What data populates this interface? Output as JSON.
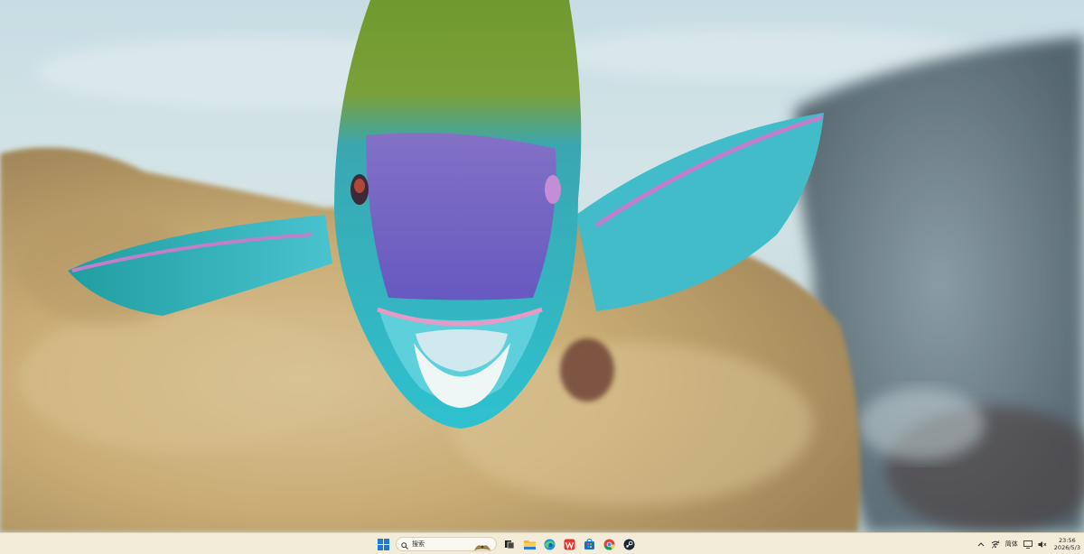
{
  "wallpaper": {
    "subject": "parrotfish-underwater-photo"
  },
  "taskbar": {
    "start_icon": "windows-start-icon",
    "search": {
      "icon": "search-icon",
      "text": "搜索"
    },
    "pinned": [
      {
        "name": "task-view-icon"
      },
      {
        "name": "file-explorer-icon"
      },
      {
        "name": "edge-browser-icon"
      },
      {
        "name": "wps-office-icon"
      },
      {
        "name": "microsoft-store-icon"
      },
      {
        "name": "chrome-icon"
      },
      {
        "name": "steam-icon"
      }
    ],
    "tray": {
      "ime_label": "简体",
      "time": "23:56",
      "date": "2026/5/3"
    }
  },
  "colors": {
    "taskbar_bg": "#f3ecd9",
    "accent": "#0078d4"
  }
}
